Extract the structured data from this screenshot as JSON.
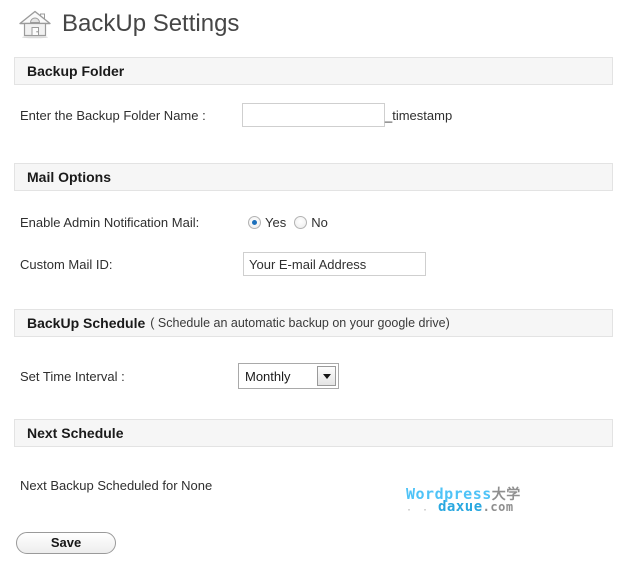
{
  "page": {
    "title": "BackUp Settings",
    "home_icon": "home-icon"
  },
  "sections": {
    "backup_folder": {
      "heading": "Backup Folder",
      "folder_name_label": "Enter the Backup Folder Name :",
      "folder_name_value": "",
      "folder_name_placeholder": "",
      "timestamp_suffix": "_timestamp"
    },
    "mail_options": {
      "heading": "Mail Options",
      "notification_label": "Enable Admin Notification Mail:",
      "radio_yes": "Yes",
      "radio_no": "No",
      "selected": "Yes",
      "mail_id_label": "Custom Mail ID:",
      "mail_id_value": "Your E-mail Address",
      "mail_id_placeholder": "Your E-mail Address"
    },
    "backup_schedule": {
      "heading": "BackUp Schedule",
      "heading_note": "( Schedule an automatic backup on your google drive)",
      "interval_label": "Set Time Interval :",
      "interval_value": "Monthly",
      "interval_options": [
        "Monthly"
      ]
    },
    "next_schedule": {
      "heading": "Next Schedule",
      "status_text": "Next Backup Scheduled for None"
    }
  },
  "footer": {
    "save_label": "Save"
  },
  "watermark": {
    "line1_latin": "Wordpress",
    "line1_cn": "大学",
    "line2_latin": "daxue",
    "line2_tld": ".com",
    "dots": "· · · ·"
  },
  "colors": {
    "accent_radio": "#1c6fbb",
    "section_bg": "#f6f6f6",
    "section_border": "#e3e3e3",
    "watermark_blue": "#29a8e0"
  }
}
